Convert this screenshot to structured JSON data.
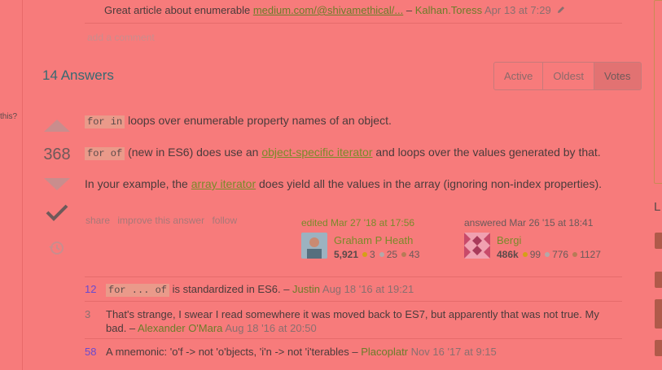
{
  "left_edge": {
    "text": "this?"
  },
  "right_edge": {
    "letter": "L"
  },
  "top_comment": {
    "text": "Great article about enumerable ",
    "link": "medium.com/@shivamethical/...",
    "sep": " – ",
    "author": "Kalhan.Toress",
    "date": " Apr 13 at 7:29"
  },
  "add_comment": "add a comment",
  "answers": {
    "title": "14 Answers",
    "tabs": [
      "Active",
      "Oldest",
      "Votes"
    ]
  },
  "answer": {
    "score": "368",
    "p1": {
      "code": "for in",
      "text": " loops over enumerable property names of an object."
    },
    "p2": {
      "code": "for of",
      "pre": " (new in ES6) does use an ",
      "link1": "object-specific iterator",
      "post": " and loops over the values generated by that."
    },
    "p3": {
      "pre": "In your example, the ",
      "link": "array iterator",
      "post": " does yield all the values in the array (ignoring non-index properties)."
    },
    "actions": [
      "share",
      "improve this answer",
      "follow"
    ],
    "edited": {
      "label": "edited Mar 27 '18 at 17:56",
      "name": "Graham P Heath",
      "rep": "5,921",
      "gold": "3",
      "silver": "25",
      "bronze": "43"
    },
    "answered": {
      "label": "answered Mar 26 '15 at 18:41",
      "name": "Bergi",
      "rep": "486k",
      "gold": "99",
      "silver": "776",
      "bronze": "1127"
    }
  },
  "comments": [
    {
      "score": "12",
      "code": "for ... of",
      "text": " is standardized in ES6. – ",
      "author": "Justin",
      "date": " Aug 18 '16 at 19:21"
    },
    {
      "score": "3",
      "line1": "That's strange, I swear I read somewhere it was moved back to ES7, but apparently that was not true. My",
      "line2": "bad. – ",
      "author": "Alexander O'Mara",
      "date": " Aug 18 '16 at 20:50"
    },
    {
      "score": "58",
      "text": "A mnemonic: 'o'f -> not 'o'bjects, 'i'n -> not 'i'terables – ",
      "author": "Placoplatr",
      "date": " Nov 16 '17 at 9:15"
    }
  ],
  "colors": {
    "background": "#f77b7b",
    "link": "#7a8a2a",
    "title": "#386a72"
  }
}
